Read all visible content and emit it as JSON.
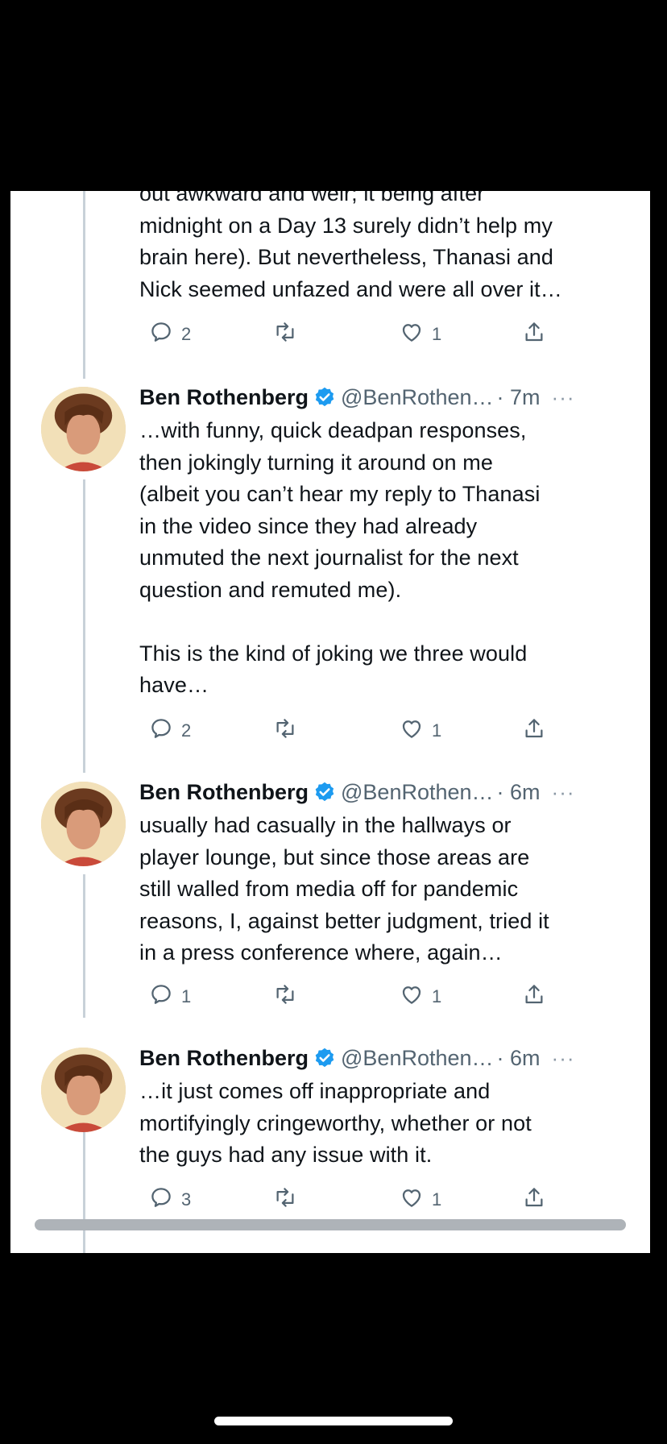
{
  "tweets": [
    {
      "text": "out awkward and weir; it being after\nmidnight on a Day 13 surely didn’t help my\nbrain here). But nevertheless, Thanasi and\nNick seemed unfazed and were all over it…",
      "replies": "2",
      "likes": "1"
    },
    {
      "name": "Ben Rothenberg",
      "handle": "@BenRothen…",
      "time": "· 7m",
      "more": "···",
      "text": "…with funny, quick deadpan responses,\nthen jokingly turning it around on me\n(albeit you can’t hear my reply to Thanasi\nin the video since they had already\nunmuted the next journalist for the next\nquestion and remuted me).\n\nThis is the kind of joking we three would\nhave…",
      "replies": "2",
      "likes": "1"
    },
    {
      "name": "Ben Rothenberg",
      "handle": "@BenRothen…",
      "time": "· 6m",
      "more": "···",
      "text": "usually had casually in the hallways or\nplayer lounge, but since those areas are\nstill walled from media off for pandemic\nreasons, I, against better judgment, tried it\nin a press conference where, again…",
      "replies": "1",
      "likes": "1"
    },
    {
      "name": "Ben Rothenberg",
      "handle": "@BenRothen…",
      "time": "· 6m",
      "more": "···",
      "text": "…it just comes off inappropriate and\nmortifyingly cringeworthy, whether or not\nthe guys had any issue with it.",
      "replies": "3",
      "likes": "1"
    }
  ],
  "icons": {
    "reply": "reply-icon",
    "retweet": "retweet-icon",
    "like": "heart-icon",
    "share": "share-icon",
    "verified": "verified-badge-icon"
  },
  "colors": {
    "verified_blue": "#1d9bf0",
    "text": "#0f1419",
    "secondary": "#536471",
    "thread_line": "#c8d1d8"
  }
}
